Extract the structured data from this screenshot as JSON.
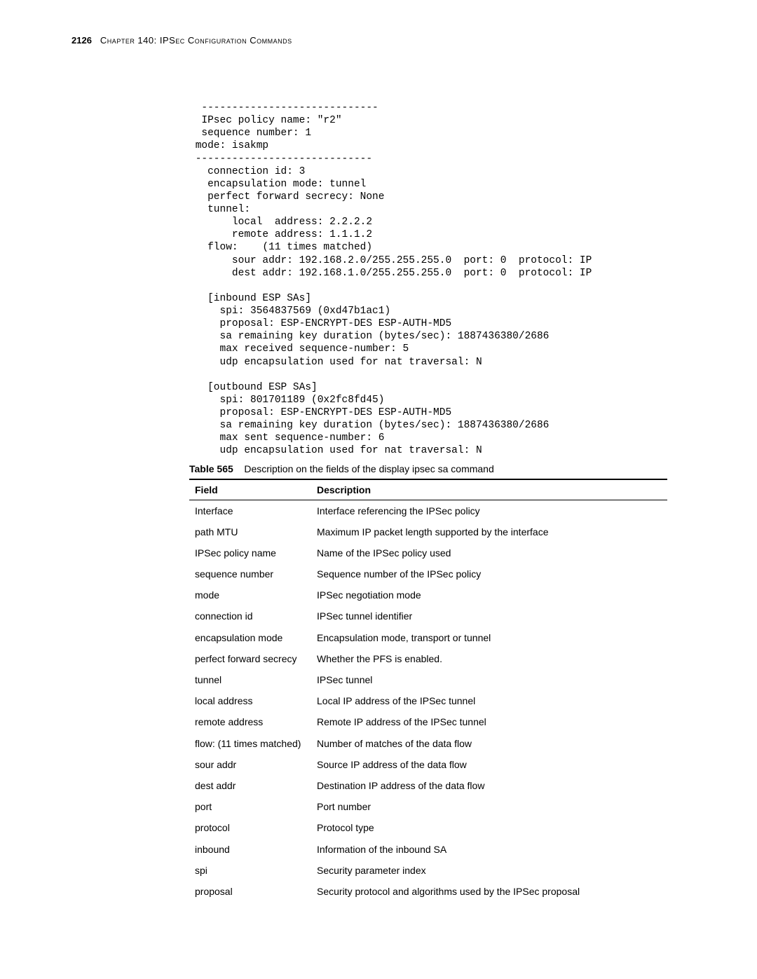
{
  "header": {
    "page_number": "2126",
    "title": "Chapter 140: IPSec Configuration Commands"
  },
  "code_lines": [
    "  -----------------------------",
    "  IPsec policy name: \"r2\"",
    "  sequence number: 1",
    " mode: isakmp",
    " -----------------------------",
    "   connection id: 3",
    "   encapsulation mode: tunnel",
    "   perfect forward secrecy: None",
    "   tunnel:",
    "       local  address: 2.2.2.2",
    "       remote address: 1.1.1.2",
    "   flow:    (11 times matched)",
    "       sour addr: 192.168.2.0/255.255.255.0  port: 0  protocol: IP",
    "       dest addr: 192.168.1.0/255.255.255.0  port: 0  protocol: IP",
    "",
    "   [inbound ESP SAs]",
    "     spi: 3564837569 (0xd47b1ac1)",
    "     proposal: ESP-ENCRYPT-DES ESP-AUTH-MD5",
    "     sa remaining key duration (bytes/sec): 1887436380/2686",
    "     max received sequence-number: 5",
    "     udp encapsulation used for nat traversal: N",
    "",
    "   [outbound ESP SAs]",
    "     spi: 801701189 (0x2fc8fd45)",
    "     proposal: ESP-ENCRYPT-DES ESP-AUTH-MD5",
    "     sa remaining key duration (bytes/sec): 1887436380/2686",
    "     max sent sequence-number: 6",
    "     udp encapsulation used for nat traversal: N"
  ],
  "table": {
    "caption_prefix": "Table 565",
    "caption_text": "Description on the fields of the display ipsec sa command",
    "head_field": "Field",
    "head_desc": "Description",
    "rows": [
      {
        "field": "Interface",
        "desc": "Interface referencing the IPSec policy"
      },
      {
        "field": "path MTU",
        "desc": "Maximum IP packet length supported by the interface"
      },
      {
        "field": "IPSec policy name",
        "desc": "Name of the IPSec policy used"
      },
      {
        "field": "sequence number",
        "desc": "Sequence number of the IPSec policy"
      },
      {
        "field": "mode",
        "desc": "IPSec negotiation mode"
      },
      {
        "field": "connection id",
        "desc": "IPSec tunnel identifier"
      },
      {
        "field": "encapsulation mode",
        "desc": "Encapsulation mode, transport or tunnel"
      },
      {
        "field": "perfect forward secrecy",
        "desc": "Whether the PFS is enabled."
      },
      {
        "field": "tunnel",
        "desc": "IPSec tunnel"
      },
      {
        "field": "local address",
        "desc": "Local IP address of the IPSec tunnel"
      },
      {
        "field": "remote address",
        "desc": "Remote IP address of the IPSec tunnel"
      },
      {
        "field": "flow: (11 times matched)",
        "desc": "Number of matches of the data flow"
      },
      {
        "field": "sour addr",
        "desc": "Source IP address of the data flow"
      },
      {
        "field": "dest addr",
        "desc": "Destination IP address of the data flow"
      },
      {
        "field": "port",
        "desc": "Port number"
      },
      {
        "field": "protocol",
        "desc": "Protocol type"
      },
      {
        "field": "inbound",
        "desc": "Information of the inbound SA"
      },
      {
        "field": "spi",
        "desc": "Security parameter index"
      },
      {
        "field": "proposal",
        "desc": "Security protocol and algorithms used by the IPSec proposal"
      }
    ]
  }
}
